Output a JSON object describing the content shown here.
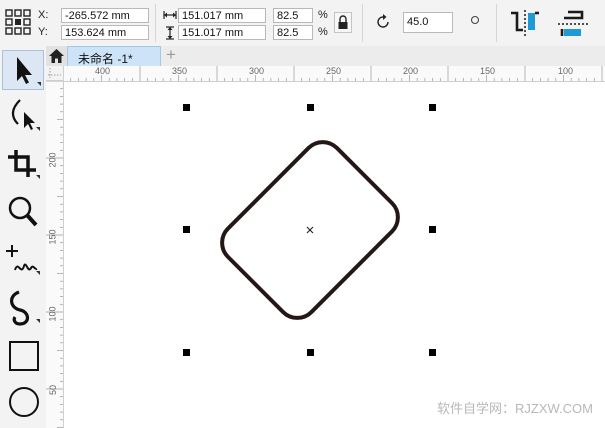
{
  "property_bar": {
    "x_label": "X:",
    "y_label": "Y:",
    "x_value": "-265.572 mm",
    "y_value": "153.624 mm",
    "width_value": "151.017 mm",
    "height_value": "151.017 mm",
    "scale_w": "82.5",
    "scale_h": "82.5",
    "percent_symbol": "%",
    "rotation_value": "45.0",
    "icons": [
      "object-origin-icon",
      "width-icon",
      "height-icon",
      "lock-ratio-icon",
      "rotate-icon",
      "rotation-center-icon",
      "mirror-horizontal-icon",
      "mirror-vertical-icon"
    ]
  },
  "toolbox": {
    "tools": [
      "pick-tool-icon",
      "shape-tool-icon",
      "crop-tool-icon",
      "zoom-tool-icon",
      "freehand-tool-icon",
      "artistic-media-icon",
      "rectangle-tool-icon",
      "ellipse-tool-icon"
    ]
  },
  "tabs": {
    "home_icon": "home-icon",
    "document_title": "未命名 -1*",
    "add_label": "+"
  },
  "ruler_h": {
    "labels": [
      "400",
      "350",
      "300",
      "250",
      "200",
      "150",
      "100"
    ]
  },
  "ruler_v": {
    "labels": [
      "200",
      "150",
      "100",
      "50"
    ]
  },
  "watermark": "软件自学网：RJZXW.COM"
}
